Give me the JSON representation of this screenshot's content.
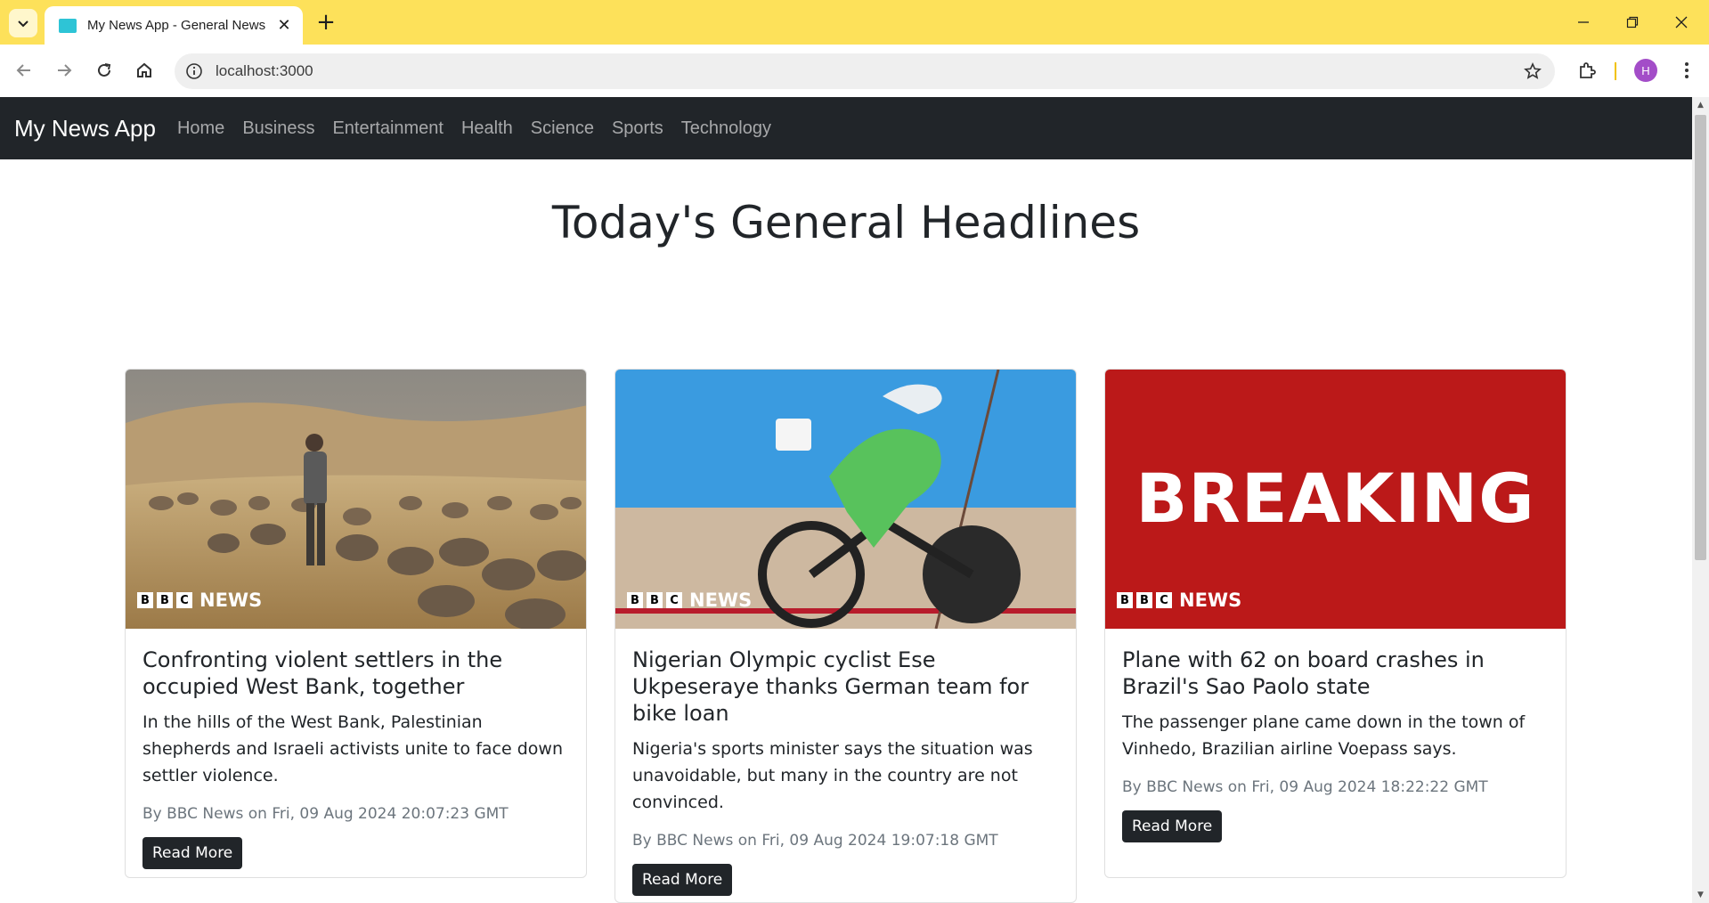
{
  "browser": {
    "tab_title": "My News App - General News",
    "url": "localhost:3000",
    "profile_initial": "H"
  },
  "navbar": {
    "brand": "My News App",
    "links": [
      "Home",
      "Business",
      "Entertainment",
      "Health",
      "Science",
      "Sports",
      "Technology"
    ]
  },
  "page": {
    "heading": "Today's General Headlines"
  },
  "cards": [
    {
      "title": "Confronting violent settlers in the occupied West Bank, together",
      "description": "In the hills of the West Bank, Palestinian shepherds and Israeli activists unite to face down settler violence.",
      "meta": "By BBC News on Fri, 09 Aug 2024 20:07:23 GMT",
      "button": "Read More",
      "image_logo": "NEWS"
    },
    {
      "title": "Nigerian Olympic cyclist Ese Ukpeseraye thanks German team for bike loan",
      "description": "Nigeria's sports minister says the situation was unavoidable, but many in the country are not convinced.",
      "meta": "By BBC News on Fri, 09 Aug 2024 19:07:18 GMT",
      "button": "Read More",
      "image_logo": "NEWS"
    },
    {
      "title": "Plane with 62 on board crashes in Brazil's Sao Paolo state",
      "description": "The passenger plane came down in the town of Vinhedo, Brazilian airline Voepass says.",
      "meta": "By BBC News on Fri, 09 Aug 2024 18:22:22 GMT",
      "button": "Read More",
      "image_logo": "NEWS",
      "image_text": "BREAKING"
    }
  ],
  "colors": {
    "tabstrip": "#fde15a",
    "navbar": "#212529",
    "breaking_red": "#bb1919"
  }
}
